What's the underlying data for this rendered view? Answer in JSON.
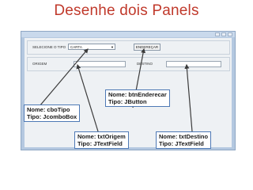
{
  "slide": {
    "title": "Desenhe dois Panels"
  },
  "panel1": {
    "label": "SELECIONE O TIPO",
    "combo_value": "CARTA",
    "button_label": "ENDEREÇAR"
  },
  "panel2": {
    "origem_label": "ORIGEM",
    "destino_label": "DESTINO"
  },
  "annotations": {
    "btn": {
      "line1": "Nome:  btnEnderecar",
      "line2": "Tipo: JButton"
    },
    "combo": {
      "line1": "Nome:  cboTipo",
      "line2": "Tipo: JcomboBox"
    },
    "origem": {
      "line1": "Nome: txtOrigem",
      "line2": "Tipo:  JTextField"
    },
    "destino": {
      "line1": "Nome: txtDestino",
      "line2": "Tipo:  JTextField"
    }
  }
}
